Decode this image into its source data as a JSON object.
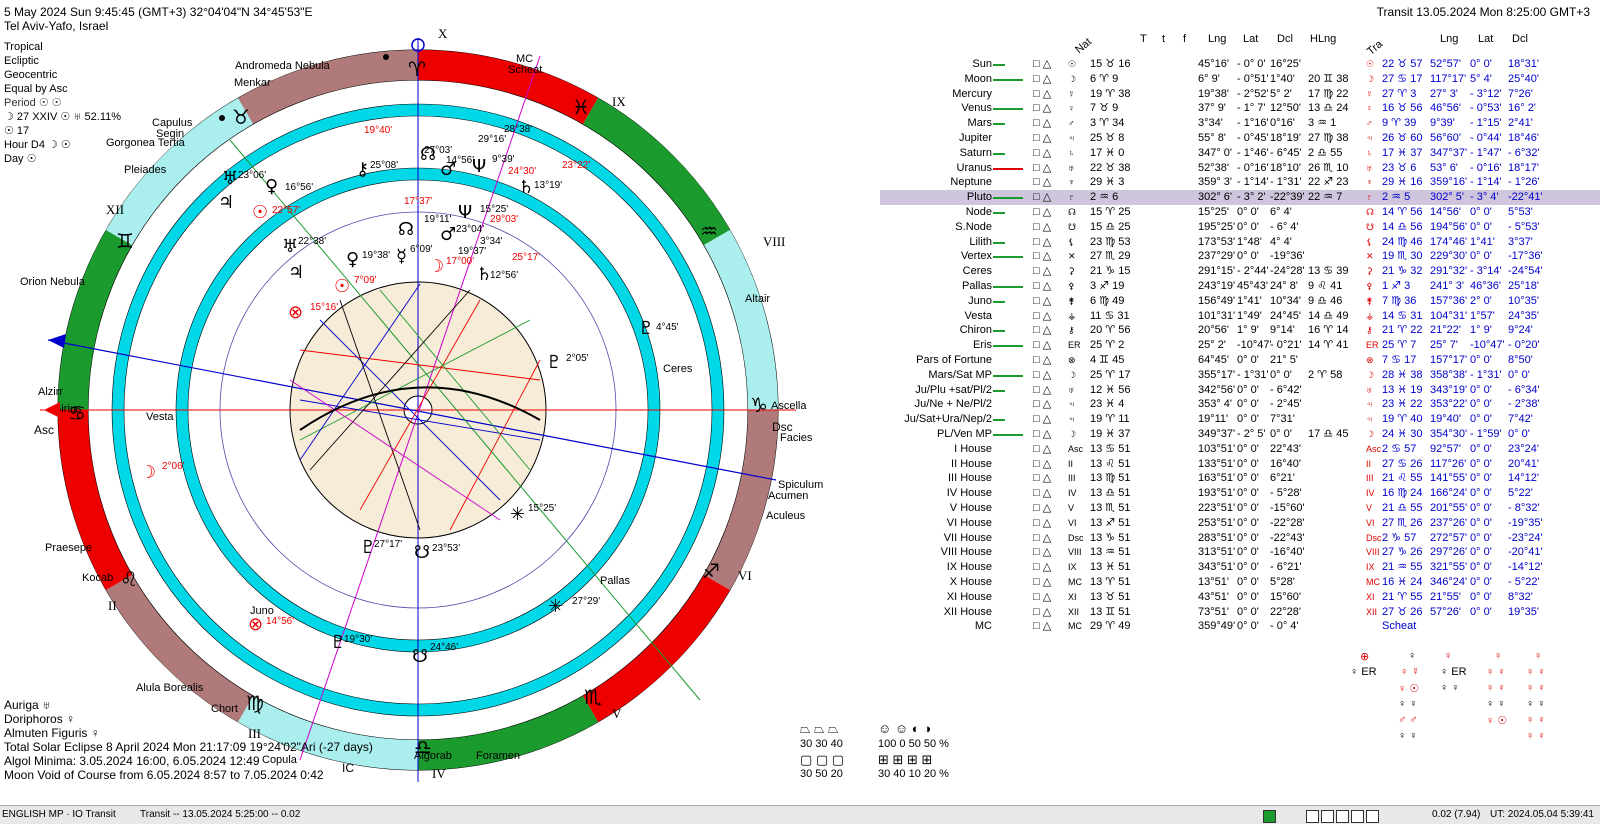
{
  "header": {
    "datetime": "5 May 2024  Sun  9:45:45 (GMT+3) 32°04'04\"N  34°45'53\"E",
    "place": "Tel Aviv-Yafo, Israel",
    "transit": "Transit 13.05.2024  Mon  8:25:00 GMT+3"
  },
  "settings": [
    "Tropical",
    "Ecliptic",
    "Geocentric",
    "Equal by Asc",
    "Period ☉ ☉",
    "☽ 27 XXIV ☉ ♅ 52.11%",
    "☉ 17",
    "Hour D4 ☽ ☉",
    "Day ☉"
  ],
  "bottom_left": {
    "stars": [
      "Auriga ♅",
      "Doriphoros ♀",
      "Almuten Figuris ♀"
    ],
    "eclipse": "Total Solar Eclipse 8 April 2024 Mon 21:17:09 19°24'02\"Ari (-27 days)",
    "algol": "Algol Minima: 3.05.2024 16:00,  6.05.2024 12:49",
    "moonvoid": "Moon Void of Course from 6.05.2024  8:57 to 7.05.2024  0:42"
  },
  "wheel": {
    "houses": [
      "X",
      "IX",
      "VIII",
      "Ascella",
      "Dsc",
      "VI",
      "V",
      "IV",
      "III",
      "II",
      "XII"
    ],
    "stars_outer": [
      "Andromeda Nebula",
      "MC",
      "Scheat",
      "Menkar",
      "Capulus",
      "Segin",
      "Gorgonea Tertia",
      "Pleiades",
      "Orion Nebula",
      "Altair",
      "Ascella",
      "Facies",
      "Spiculum",
      "Acumen",
      "Aculeus",
      "Praesepe",
      "Kocab",
      "Alula Borealis",
      "Chort",
      "Algorab",
      "Foramen",
      "Copula",
      "Alzirr",
      "Sirius",
      "Asc",
      "IC",
      "Ceres",
      "Pallas",
      "Vesta",
      "Juno"
    ],
    "deg_labels": [
      "19°40'",
      "23°06'",
      "16°56'",
      "22°57'",
      "22°38'",
      "25°08'",
      "27°03'",
      "14°56'",
      "9°39'",
      "29°16'",
      "28°38'",
      "24°30'",
      "23°22'",
      "13°19'",
      "17°37'",
      "19°11'",
      "15°25'",
      "29°03'",
      "23°04'",
      "3°34'",
      "19°37'",
      "25°17'",
      "12°56'",
      "17°00'",
      "6°09'",
      "19°38'",
      "7°09'",
      "15°16'",
      "4°45'",
      "2°05'",
      "2°06'",
      "27°17'",
      "23°53'",
      "15°25'",
      "27°29'",
      "19°30'",
      "24°46'",
      "14°56'",
      "7°17'"
    ]
  },
  "table": {
    "columns": [
      "Nat",
      "T",
      "t",
      "f",
      "Lng",
      "Lat",
      "Dcl",
      "HLng",
      "Tra",
      "Lng",
      "Lat",
      "Dcl"
    ],
    "rows": [
      {
        "name": "Sun",
        "nat": "15 ♉ 16",
        "lng": "45°16'",
        "lat": "- 0° 0'",
        "dcl": "16°25'",
        "hlng": "",
        "tra": "22 ♉ 57",
        "tlng": "52°57'",
        "tlat": "0° 0'",
        "tdcl": "18°31'"
      },
      {
        "name": "Moon",
        "nat": "6 ♈ 9",
        "lng": "6° 9'",
        "lat": "- 0°51'",
        "dcl": "1°40'",
        "hlng": "20 ♊ 38",
        "tra": "27 ♋ 17",
        "tlng": "117°17'",
        "tlat": "5° 4'",
        "tdcl": "25°40'"
      },
      {
        "name": "Mercury",
        "nat": "19 ♈ 38",
        "lng": "19°38'",
        "lat": "- 2°52'",
        "dcl": "5° 2'",
        "hlng": "17 ♍ 22",
        "tra": "27 ♈ 3",
        "tlng": "27° 3'",
        "tlat": "- 3°12'",
        "tdcl": "7°26'"
      },
      {
        "name": "Venus",
        "nat": "7 ♉ 9",
        "lng": "37° 9'",
        "lat": "- 1° 7'",
        "dcl": "12°50'",
        "hlng": "13 ♎ 24",
        "tra": "16 ♉ 56",
        "tlng": "46°56'",
        "tlat": "- 0°53'",
        "tdcl": "16° 2'"
      },
      {
        "name": "Mars",
        "nat": "3 ♈ 34",
        "lng": "3°34'",
        "lat": "- 1°16'",
        "dcl": "0°16'",
        "hlng": "3 ♒ 1",
        "tra": "9 ♈ 39",
        "tlng": "9°39'",
        "tlat": "- 1°15'",
        "tdcl": "2°41'"
      },
      {
        "name": "Jupiter",
        "nat": "25 ♉ 8",
        "lng": "55° 8'",
        "lat": "- 0°45'",
        "dcl": "18°19'",
        "hlng": "27 ♍ 38",
        "tra": "26 ♉ 60",
        "tlng": "56°60'",
        "tlat": "- 0°44'",
        "tdcl": "18°46'"
      },
      {
        "name": "Saturn",
        "nat": "17 ♓ 0",
        "lng": "347° 0'",
        "lat": "- 1°46'",
        "dcl": "- 6°45'",
        "hlng": "2 ♎ 55",
        "tra": "17 ♓ 37",
        "tlng": "347°37'",
        "tlat": "- 1°47'",
        "tdcl": "- 6°32'"
      },
      {
        "name": "Uranus",
        "nat": "22 ♉ 38",
        "lng": "52°38'",
        "lat": "- 0°16'",
        "dcl": "18°10'",
        "hlng": "26 ♏ 10",
        "tra": "23 ♉ 6",
        "tlng": "53° 6'",
        "tlat": "- 0°16'",
        "tdcl": "18°17'"
      },
      {
        "name": "Neptune",
        "nat": "29 ♓ 3",
        "lng": "359° 3'",
        "lat": "- 1°14'",
        "dcl": "- 1°31'",
        "hlng": "22 ♐ 23",
        "tra": "29 ♓ 16",
        "tlng": "359°16'",
        "tlat": "- 1°14'",
        "tdcl": "- 1°26'"
      },
      {
        "name": "Pluto",
        "nat": "2 ♒ 6",
        "lng": "302° 6'",
        "lat": "- 3° 2'",
        "dcl": "-22°39'",
        "hlng": "22 ♒ 7",
        "tra": "2 ♒ 5",
        "tlng": "302° 5'",
        "tlat": "- 3° 4'",
        "tdcl": "-22°41'"
      },
      {
        "name": "Node",
        "nat": "15 ♈ 25",
        "lng": "15°25'",
        "lat": "0° 0'",
        "dcl": "6° 4'",
        "hlng": "",
        "tra": "14 ♈ 56",
        "tlng": "14°56'",
        "tlat": "0° 0'",
        "tdcl": "5°53'"
      },
      {
        "name": "S.Node",
        "nat": "15 ♎ 25",
        "lng": "195°25'",
        "lat": "0° 0'",
        "dcl": "- 6° 4'",
        "hlng": "",
        "tra": "14 ♎ 56",
        "tlng": "194°56'",
        "tlat": "0° 0'",
        "tdcl": "- 5°53'"
      },
      {
        "name": "Lilith",
        "nat": "23 ♍ 53",
        "lng": "173°53'",
        "lat": "1°48'",
        "dcl": "4° 4'",
        "hlng": "",
        "tra": "24 ♍ 46",
        "tlng": "174°46'",
        "tlat": "1°41'",
        "tdcl": "3°37'"
      },
      {
        "name": "Vertex",
        "nat": "27 ♏ 29",
        "lng": "237°29'",
        "lat": "0° 0'",
        "dcl": "-19°36'",
        "hlng": "",
        "tra": "19 ♏ 30",
        "tlng": "229°30'",
        "tlat": "0° 0'",
        "tdcl": "-17°36'"
      },
      {
        "name": "Ceres",
        "nat": "21 ♑ 15",
        "lng": "291°15'",
        "lat": "- 2°44'",
        "dcl": "-24°28'",
        "hlng": "13 ♋ 39",
        "tra": "21 ♑ 32",
        "tlng": "291°32'",
        "tlat": "- 3°14'",
        "tdcl": "-24°54'"
      },
      {
        "name": "Pallas",
        "nat": "3 ♐ 19",
        "lng": "243°19'",
        "lat": "45°43'",
        "dcl": "24° 8'",
        "hlng": "9 ♌ 41",
        "tra": "1 ♐ 3",
        "tlng": "241° 3'",
        "tlat": "46°36'",
        "tdcl": "25°18'"
      },
      {
        "name": "Juno",
        "nat": "6 ♍ 49",
        "lng": "156°49'",
        "lat": "1°41'",
        "dcl": "10°34'",
        "hlng": "9 ♎ 46",
        "tra": "7 ♍ 36",
        "tlng": "157°36'",
        "tlat": "2° 0'",
        "tdcl": "10°35'"
      },
      {
        "name": "Vesta",
        "nat": "11 ♋ 31",
        "lng": "101°31'",
        "lat": "1°49'",
        "dcl": "24°45'",
        "hlng": "14 ♎ 49",
        "tra": "14 ♋ 31",
        "tlng": "104°31'",
        "tlat": "1°57'",
        "tdcl": "24°35'"
      },
      {
        "name": "Chiron",
        "nat": "20 ♈ 56",
        "lng": "20°56'",
        "lat": "1° 9'",
        "dcl": "9°14'",
        "hlng": "16 ♈ 14",
        "tra": "21 ♈ 22",
        "tlng": "21°22'",
        "tlat": "1° 9'",
        "tdcl": "9°24'"
      },
      {
        "name": "Eris",
        "nat": "25 ♈ 2",
        "lng": "25° 2'",
        "lat": "-10°47'",
        "dcl": "- 0°21'",
        "hlng": "14 ♈ 41",
        "tra": "25 ♈ 7",
        "tlng": "25° 7'",
        "tlat": "-10°47'",
        "tdcl": "- 0°20'"
      },
      {
        "name": "Pars of Fortune",
        "nat": "4 ♊ 45",
        "lng": "64°45'",
        "lat": "0° 0'",
        "dcl": "21° 5'",
        "hlng": "",
        "tra": "7 ♋ 17",
        "tlng": "157°17'",
        "tlat": "0° 0'",
        "tdcl": "8°50'"
      },
      {
        "name": "Mars/Sat MP",
        "nat": "25 ♈ 17",
        "lng": "355°17'",
        "lat": "- 1°31'",
        "dcl": "0° 0'",
        "hlng": "2 ♈ 58",
        "tra": "28 ♓ 38",
        "tlng": "358°38'",
        "tlat": "- 1°31'",
        "tdcl": "0° 0'"
      },
      {
        "name": "Ju/Plu +sat/Pl/2",
        "nat": "12 ♓ 56",
        "lng": "342°56'",
        "lat": "0° 0'",
        "dcl": "- 6°42'",
        "hlng": "",
        "tra": "13 ♓ 19",
        "tlng": "343°19'",
        "tlat": "0° 0'",
        "tdcl": "- 6°34'"
      },
      {
        "name": "Ju/Ne + Ne/Pl/2",
        "nat": "23 ♓ 4",
        "lng": "353° 4'",
        "lat": "0° 0'",
        "dcl": "- 2°45'",
        "hlng": "",
        "tra": "23 ♓ 22",
        "tlng": "353°22'",
        "tlat": "0° 0'",
        "tdcl": "- 2°38'"
      },
      {
        "name": "Ju/Sat+Ura/Nep/2",
        "nat": "19 ♈ 11",
        "lng": "19°11'",
        "lat": "0° 0'",
        "dcl": "7°31'",
        "hlng": "",
        "tra": "19 ♈ 40",
        "tlng": "19°40'",
        "tlat": "0° 0'",
        "tdcl": "7°42'"
      },
      {
        "name": "PL/Ven MP",
        "nat": "19 ♓ 37",
        "lng": "349°37'",
        "lat": "- 2° 5'",
        "dcl": "0° 0'",
        "hlng": "17 ♎ 45",
        "tra": "24 ♓ 30",
        "tlng": "354°30'",
        "tlat": "- 1°59'",
        "tdcl": "0° 0'"
      },
      {
        "name": "I House",
        "nat": "13 ♋ 51",
        "lng": "103°51'",
        "lat": "0° 0'",
        "dcl": "22°43'",
        "hlng": "",
        "tra": "2 ♋ 57",
        "tlng": "92°57'",
        "tlat": "0° 0'",
        "tdcl": "23°24'"
      },
      {
        "name": "II House",
        "nat": "13 ♌ 51",
        "lng": "133°51'",
        "lat": "0° 0'",
        "dcl": "16°40'",
        "hlng": "",
        "tra": "27 ♋ 26",
        "tlng": "117°26'",
        "tlat": "0° 0'",
        "tdcl": "20°41'"
      },
      {
        "name": "III House",
        "nat": "13 ♍ 51",
        "lng": "163°51'",
        "lat": "0° 0'",
        "dcl": "6°21'",
        "hlng": "",
        "tra": "21 ♌ 55",
        "tlng": "141°55'",
        "tlat": "0° 0'",
        "tdcl": "14°12'"
      },
      {
        "name": "IV House",
        "nat": "13 ♎ 51",
        "lng": "193°51'",
        "lat": "0° 0'",
        "dcl": "- 5°28'",
        "hlng": "",
        "tra": "16 ♍ 24",
        "tlng": "166°24'",
        "tlat": "0° 0'",
        "tdcl": "5°22'"
      },
      {
        "name": "V House",
        "nat": "13 ♏ 51",
        "lng": "223°51'",
        "lat": "0° 0'",
        "dcl": "-15°60'",
        "hlng": "",
        "tra": "21 ♎ 55",
        "tlng": "201°55'",
        "tlat": "0° 0'",
        "tdcl": "- 8°32'"
      },
      {
        "name": "VI House",
        "nat": "13 ♐ 51",
        "lng": "253°51'",
        "lat": "0° 0'",
        "dcl": "-22°28'",
        "hlng": "",
        "tra": "27 ♏ 26",
        "tlng": "237°26'",
        "tlat": "0° 0'",
        "tdcl": "-19°35'"
      },
      {
        "name": "VII House",
        "nat": "13 ♑ 51",
        "lng": "283°51'",
        "lat": "0° 0'",
        "dcl": "-22°43'",
        "hlng": "",
        "tra": "2 ♑ 57",
        "tlng": "272°57'",
        "tlat": "0° 0'",
        "tdcl": "-23°24'"
      },
      {
        "name": "VIII House",
        "nat": "13 ♒ 51",
        "lng": "313°51'",
        "lat": "0° 0'",
        "dcl": "-16°40'",
        "hlng": "",
        "tra": "27 ♑ 26",
        "tlng": "297°26'",
        "tlat": "0° 0'",
        "tdcl": "-20°41'"
      },
      {
        "name": "IX House",
        "nat": "13 ♓ 51",
        "lng": "343°51'",
        "lat": "0° 0'",
        "dcl": "- 6°21'",
        "hlng": "",
        "tra": "21 ♒ 55",
        "tlng": "321°55'",
        "tlat": "0° 0'",
        "tdcl": "-14°12'"
      },
      {
        "name": "X House",
        "nat": "13 ♈ 51",
        "lng": "13°51'",
        "lat": "0° 0'",
        "dcl": "5°28'",
        "hlng": "",
        "tra": "16 ♓ 24",
        "tlng": "346°24'",
        "tlat": "0° 0'",
        "tdcl": "- 5°22'"
      },
      {
        "name": "XI House",
        "nat": "13 ♉ 51",
        "lng": "43°51'",
        "lat": "0° 0'",
        "dcl": "15°60'",
        "hlng": "",
        "tra": "21 ♈ 55",
        "tlng": "21°55'",
        "tlat": "0° 0'",
        "tdcl": "8°32'"
      },
      {
        "name": "XII House",
        "nat": "13 ♊ 51",
        "lng": "73°51'",
        "lat": "0° 0'",
        "dcl": "22°28'",
        "hlng": "",
        "tra": "27 ♉ 26",
        "tlng": "57°26'",
        "tlat": "0° 0'",
        "tdcl": "19°35'"
      },
      {
        "name": "MC",
        "nat": "29 ♈ 49",
        "lng": "359°49'",
        "lat": "0° 0'",
        "dcl": "- 0° 4'",
        "hlng": "",
        "tra": "Scheat",
        "tlng": "",
        "tlat": "",
        "tdcl": ""
      }
    ]
  },
  "elements": {
    "row1": "30  30  40",
    "row2": "30  50  20",
    "row3": "100 0   50  50 %",
    "row4": "30  40  10  20 %"
  },
  "statusbar": {
    "left": "ENGLISH MP · IO Transit",
    "transit": "Transit -- 13.05.2024  5:25:00 -- 0.02",
    "value": "0.02 (7.94)",
    "ut": "UT: 2024.05.04  5:39:41"
  }
}
